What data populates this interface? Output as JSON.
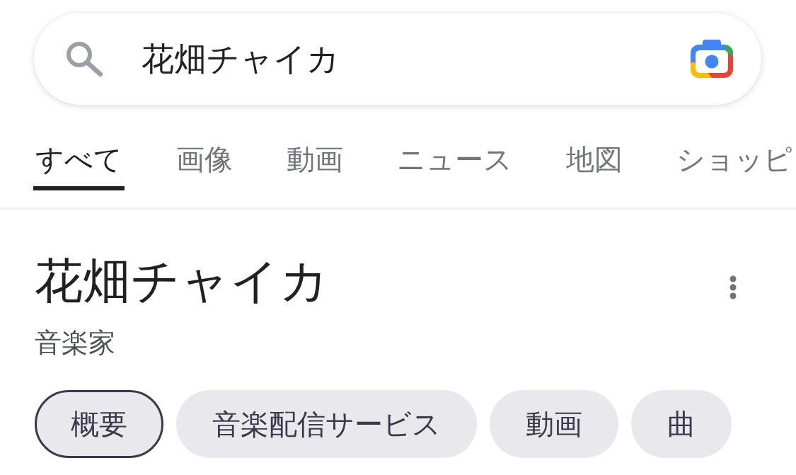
{
  "search": {
    "value": "花畑チャイカ"
  },
  "tabs": [
    {
      "label": "すべて",
      "selected": true
    },
    {
      "label": "画像",
      "selected": false
    },
    {
      "label": "動画",
      "selected": false
    },
    {
      "label": "ニュース",
      "selected": false
    },
    {
      "label": "地図",
      "selected": false
    },
    {
      "label": "ショッピ",
      "selected": false
    }
  ],
  "entity": {
    "title": "花畑チャイカ",
    "subtitle": "音楽家"
  },
  "chips": [
    {
      "label": "概要",
      "selected": true
    },
    {
      "label": "音楽配信サービス",
      "selected": false
    },
    {
      "label": "動画",
      "selected": false
    },
    {
      "label": "曲",
      "selected": false
    }
  ]
}
